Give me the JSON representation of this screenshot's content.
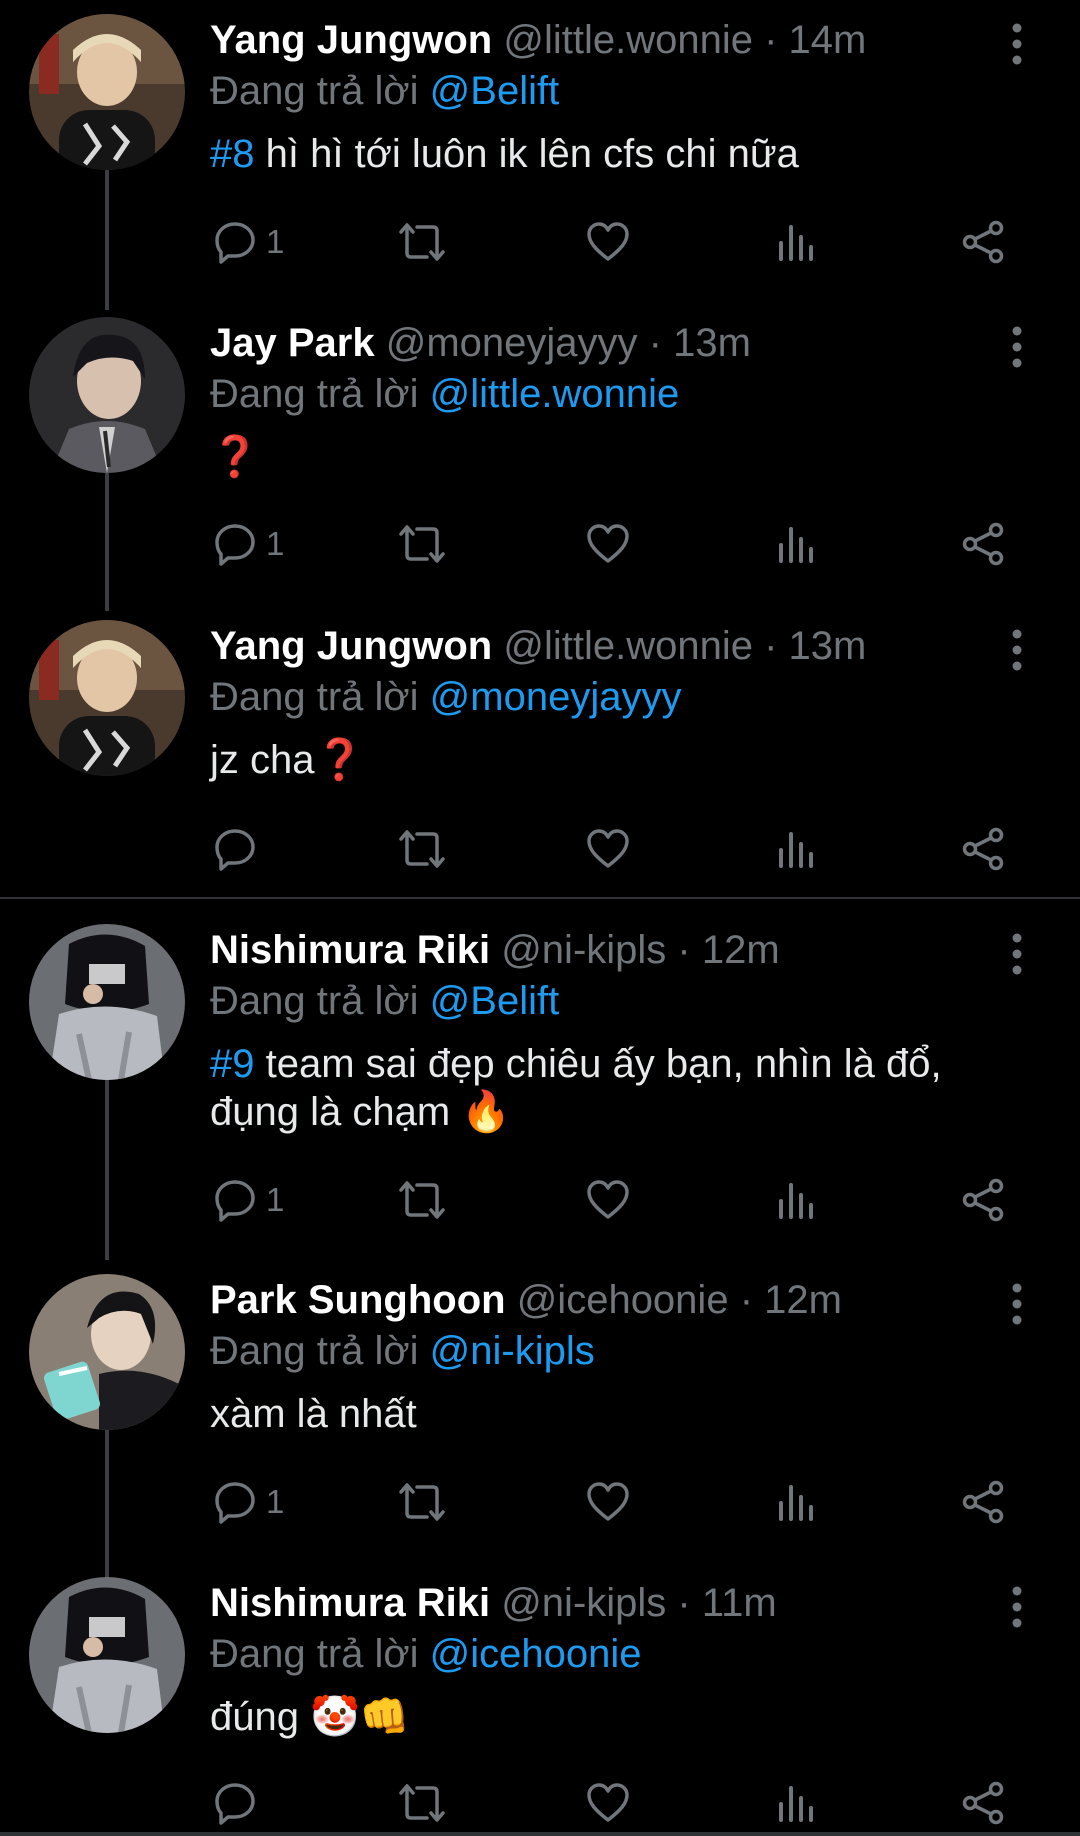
{
  "tweets": [
    {
      "name": "Yang Jungwon",
      "handle": "@little.wonnie",
      "separator": "·",
      "time": "14m",
      "replying_label": "Đang trả lời",
      "replying_to": "@Belift",
      "hashtag": "#8",
      "text": " hì hì tới luôn ik lên cfs chi nữa",
      "reply_count": "1",
      "avatar": "avatar-jungwon"
    },
    {
      "name": "Jay Park",
      "handle": "@moneyjayyy",
      "separator": "·",
      "time": "13m",
      "replying_label": "Đang trả lời",
      "replying_to": "@little.wonnie",
      "hashtag": "",
      "text": "❓",
      "reply_count": "1",
      "avatar": "avatar-jay"
    },
    {
      "name": "Yang Jungwon",
      "handle": "@little.wonnie",
      "separator": "·",
      "time": "13m",
      "replying_label": "Đang trả lời",
      "replying_to": "@moneyjayyy",
      "hashtag": "",
      "text": "jz cha❓",
      "reply_count": "",
      "avatar": "avatar-jungwon"
    },
    {
      "name": "Nishimura Riki",
      "handle": "@ni-kipls",
      "separator": "·",
      "time": "12m",
      "replying_label": "Đang trả lời",
      "replying_to": "@Belift",
      "hashtag": "#9",
      "text": " team sai đẹp chiêu ấy bạn, nhìn là đổ, đụng là chạm 🔥",
      "reply_count": "1",
      "avatar": "avatar-riki"
    },
    {
      "name": "Park Sunghoon",
      "handle": "@icehoonie",
      "separator": "·",
      "time": "12m",
      "replying_label": "Đang trả lời",
      "replying_to": "@ni-kipls",
      "hashtag": "",
      "text": "xàm là nhất",
      "reply_count": "1",
      "avatar": "avatar-sunghoon"
    },
    {
      "name": "Nishimura Riki",
      "handle": "@ni-kipls",
      "separator": "·",
      "time": "11m",
      "replying_label": "Đang trả lời",
      "replying_to": "@icehoonie",
      "hashtag": "",
      "text": "đúng 🤡👊",
      "reply_count": "",
      "avatar": "avatar-riki"
    }
  ],
  "colors": {
    "background": "#000000",
    "link_blue": "#1d9bf0",
    "muted_gray": "#71767b",
    "text": "#e7e9ea"
  },
  "icons": [
    "reply-icon",
    "retweet-icon",
    "like-icon",
    "views-icon",
    "share-icon",
    "more-icon"
  ]
}
